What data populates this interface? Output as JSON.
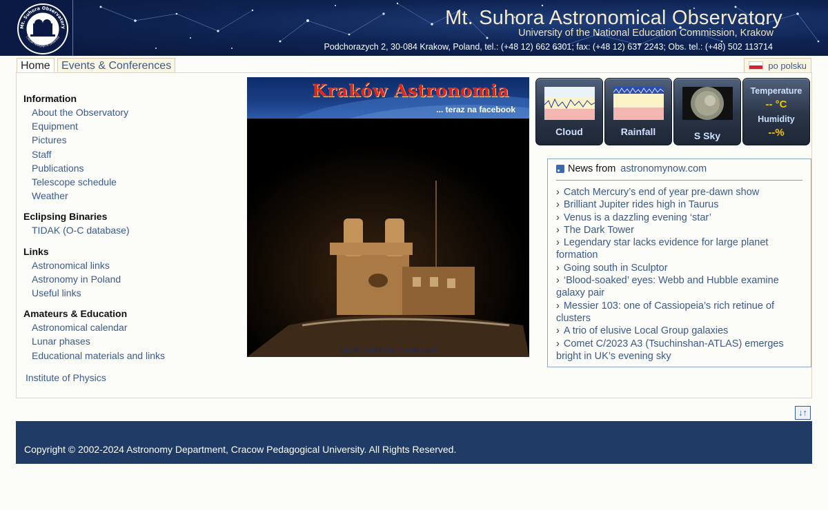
{
  "header": {
    "title": "Mt. Suhora Astronomical Observatory",
    "subtitle": "University of the National Education Commission, Krakow",
    "address": "Podchorazych 2, 30-084 Krakow, Poland, tel.: (+48 12) 662 6301; fax: (+48 12) 637 2243; Obs. tel.: (+48) 502 113714",
    "logo_text_top": "Mt. Suhora Observatory",
    "logo_text_bottom": "Cracow Pedagogical University"
  },
  "tabs": {
    "home": "Home",
    "events": "Events & Conferences"
  },
  "language": {
    "label": "po polsku",
    "flag_icon": "polish-flag-icon"
  },
  "sidebar": {
    "sections": [
      {
        "title": "Information",
        "links": [
          "About the Observatory",
          "Equipment",
          "Pictures",
          "Staff",
          "Publications",
          "Telescope schedule",
          "Weather"
        ]
      },
      {
        "title": "Eclipsing Binaries",
        "links": [
          "TIDAK (O-C database)"
        ]
      },
      {
        "title": "Links",
        "links": [
          "Astronomical links",
          "Astronomy in Poland",
          "Useful links"
        ]
      },
      {
        "title": "Amateurs & Education",
        "links": [
          "Astronomical calendar",
          "Lunar phases",
          "Educational materials and links"
        ]
      }
    ],
    "institute_link": "Institute of Physics"
  },
  "photo": {
    "banner_title": "Kraków Astronomia",
    "banner_sub": "... teraz na facebook",
    "caption": "night view from south-east"
  },
  "widgets": {
    "cloud_label": "Cloud",
    "rainfall_label": "Rainfall",
    "sky_label": "S Sky",
    "temperature_label": "Temperature",
    "temperature_value": "-- °C",
    "humidity_label": "Humidity",
    "humidity_value": "--%",
    "accent_color": "#f2c400"
  },
  "news": {
    "heading": "News from",
    "source": "astronomynow.com",
    "items": [
      "Catch Mercury’s end of year pre-dawn show",
      "Brilliant Jupiter rides high in Taurus",
      "Venus is a dazzling evening ‘star’",
      "The Dark Tower",
      "Legendary star lacks evidence for large planet formation",
      "Going south in Sculptor",
      "‘Blood-soaked’ eyes: Webb and Hubble examine galaxy pair",
      "Messier 103: one of Cassiopeia’s rich retinue of clusters",
      "A trio of elusive Local Group galaxies",
      "Comet C/2023 A3 (Tsuchinshan-ATLAS) emerges bright in UK’s evening sky"
    ]
  },
  "footer": {
    "copyright": "Copyright © 2002-2024 Astronomy Department, Cracow Pedagogical University. All Rights Reserved."
  },
  "colors": {
    "link": "#3a5a8c",
    "footer_bg": "#1f3b66",
    "header_bg": "#0f2454"
  }
}
